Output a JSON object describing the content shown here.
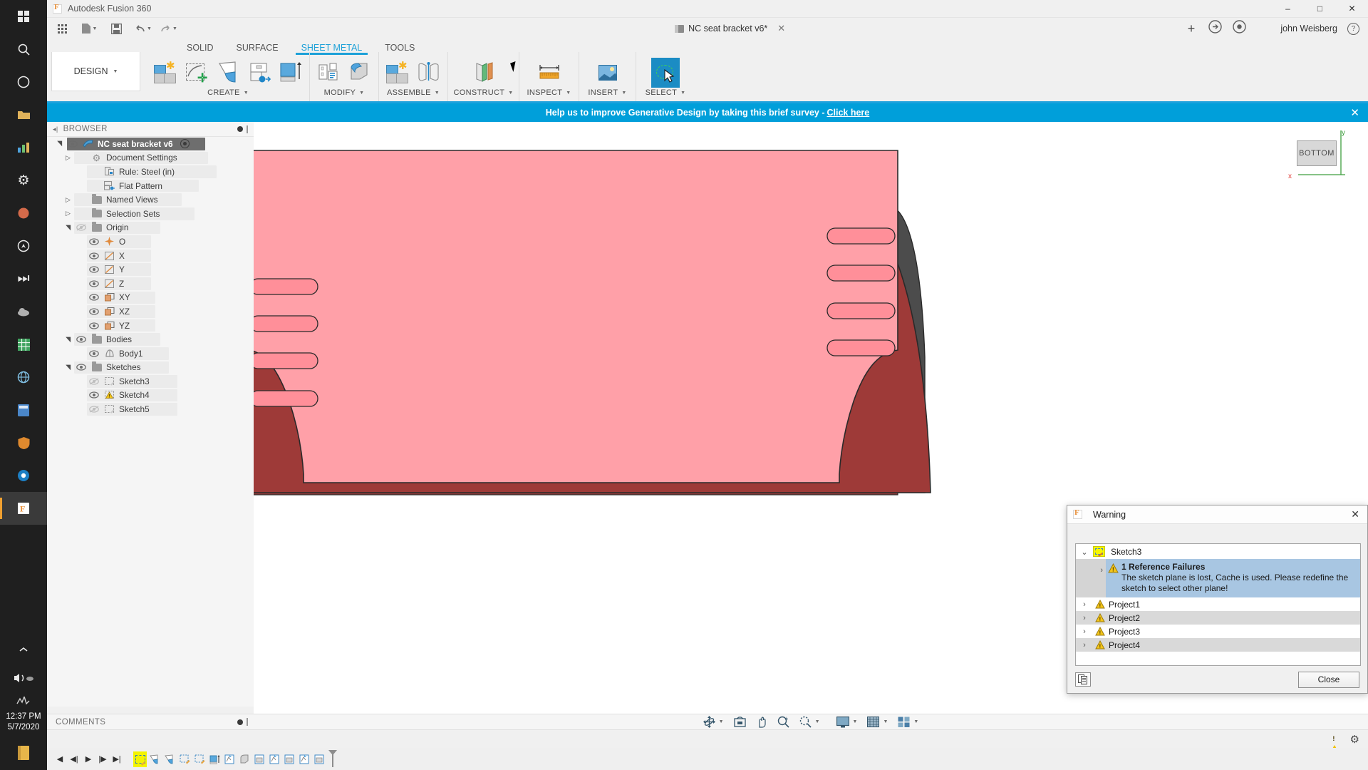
{
  "window": {
    "app_title": "Autodesk Fusion 360",
    "minimize": "–",
    "maximize": "□",
    "close": "✕"
  },
  "taskbar": {
    "clock_time": "12:37 PM",
    "clock_date": "5/7/2020",
    "icons": [
      "windows-start-icon",
      "search-icon",
      "circle-icon",
      "folder-icon",
      "chart-icon",
      "gear-icon",
      "paint-icon",
      "compass-icon",
      "skip-icon",
      "cloud-icon",
      "grid-icon",
      "globe-icon",
      "calculator-icon",
      "shield-icon",
      "browser-icon",
      "fusion-icon"
    ],
    "tray": [
      "chevron-up-icon",
      "volume-icon",
      "cloud-icon",
      "activity-icon"
    ],
    "bottom": [
      "book-icon"
    ]
  },
  "quick_access": {
    "apps_label": "",
    "new_label": "",
    "save_label": "",
    "undo_label": "",
    "redo_label": "",
    "document_tab": "NC seat bracket v6*",
    "tab_close": "✕",
    "add_tab": "+",
    "user_name": "john Weisberg",
    "help_label": "?"
  },
  "ribbon": {
    "design_dropdown": "DESIGN",
    "workspace_tabs": [
      {
        "label": "SOLID",
        "active": false
      },
      {
        "label": "SURFACE",
        "active": false
      },
      {
        "label": "SHEET METAL",
        "active": true
      },
      {
        "label": "TOOLS",
        "active": false
      }
    ],
    "groups": [
      {
        "label": "CREATE",
        "has_caret": true,
        "icons": [
          "new-sheet-metal-component-icon",
          "create-sketch-icon",
          "flange-icon",
          "unfold-icon",
          "extrude-icon"
        ]
      },
      {
        "label": "MODIFY",
        "has_caret": true,
        "icons": [
          "press-pull-icon",
          "fillet-icon"
        ]
      },
      {
        "label": "ASSEMBLE",
        "has_caret": true,
        "icons": [
          "new-component-icon",
          "joint-icon"
        ]
      },
      {
        "label": "CONSTRUCT",
        "has_caret": true,
        "icons": [
          "offset-plane-icon"
        ]
      },
      {
        "label": "INSPECT",
        "has_caret": true,
        "icons": [
          "measure-icon"
        ]
      },
      {
        "label": "INSERT",
        "has_caret": true,
        "icons": [
          "insert-image-icon"
        ]
      },
      {
        "label": "SELECT",
        "has_caret": true,
        "icons": [
          "select-icon"
        ],
        "selected": true
      }
    ]
  },
  "banner": {
    "text": "Help us to improve Generative Design by taking this brief survey -",
    "link": "Click here",
    "close": "✕"
  },
  "browser": {
    "title": "BROWSER",
    "tree": [
      {
        "label": "NC seat bracket v6",
        "indent": 0,
        "tri": "open",
        "eye": true,
        "icon": "component-icon",
        "root": true,
        "target": true
      },
      {
        "label": "Document Settings",
        "indent": 1,
        "tri": "closed",
        "eye": false,
        "icon": "gear-icon"
      },
      {
        "label": "Rule: Steel (in)",
        "indent": 2,
        "tri": "none",
        "eye": false,
        "icon": "rule-icon"
      },
      {
        "label": "Flat Pattern",
        "indent": 2,
        "tri": "none",
        "eye": false,
        "icon": "flat-pattern-icon"
      },
      {
        "label": "Named Views",
        "indent": 1,
        "tri": "closed",
        "eye": false,
        "icon": "folder-icon"
      },
      {
        "label": "Selection Sets",
        "indent": 1,
        "tri": "closed",
        "eye": false,
        "icon": "folder-icon"
      },
      {
        "label": "Origin",
        "indent": 1,
        "tri": "open",
        "eye": true,
        "eye_off": true,
        "icon": "folder-icon"
      },
      {
        "label": "O",
        "indent": 2,
        "tri": "none",
        "eye": true,
        "icon": "origin-point-icon"
      },
      {
        "label": "X",
        "indent": 2,
        "tri": "none",
        "eye": true,
        "icon": "axis-icon"
      },
      {
        "label": "Y",
        "indent": 2,
        "tri": "none",
        "eye": true,
        "icon": "axis-icon"
      },
      {
        "label": "Z",
        "indent": 2,
        "tri": "none",
        "eye": true,
        "icon": "axis-icon"
      },
      {
        "label": "XY",
        "indent": 2,
        "tri": "none",
        "eye": true,
        "icon": "plane-icon"
      },
      {
        "label": "XZ",
        "indent": 2,
        "tri": "none",
        "eye": true,
        "icon": "plane-icon"
      },
      {
        "label": "YZ",
        "indent": 2,
        "tri": "none",
        "eye": true,
        "icon": "plane-icon"
      },
      {
        "label": "Bodies",
        "indent": 1,
        "tri": "open",
        "eye": true,
        "icon": "folder-icon"
      },
      {
        "label": "Body1",
        "indent": 2,
        "tri": "none",
        "eye": true,
        "icon": "body-icon"
      },
      {
        "label": "Sketches",
        "indent": 1,
        "tri": "open",
        "eye": true,
        "icon": "folder-icon"
      },
      {
        "label": "Sketch3",
        "indent": 2,
        "tri": "none",
        "eye": true,
        "eye_off": true,
        "icon": "sketch-icon"
      },
      {
        "label": "Sketch4",
        "indent": 2,
        "tri": "none",
        "eye": true,
        "icon": "sketch-warning-icon"
      },
      {
        "label": "Sketch5",
        "indent": 2,
        "tri": "none",
        "eye": true,
        "eye_off": true,
        "icon": "sketch-icon"
      }
    ]
  },
  "comments": {
    "title": "COMMENTS"
  },
  "canvas": {
    "viewcube_label": "BOTTOM",
    "axis_x": "x",
    "axis_y": "y",
    "model_name": "NC seat bracket sheet metal part",
    "colors": {
      "face_light": "#ffa0a8",
      "face_dark": "#9e3a38",
      "edge": "#2a2a2a",
      "side_gray": "#4c4c4c"
    }
  },
  "navbar": {
    "items": [
      {
        "name": "orbit-icon",
        "caret": true
      },
      {
        "name": "look-at-icon",
        "caret": false
      },
      {
        "name": "pan-icon",
        "caret": false
      },
      {
        "name": "zoom-icon",
        "caret": false
      },
      {
        "name": "fit-icon",
        "caret": true
      },
      {
        "name": "display-settings-icon",
        "caret": true
      },
      {
        "name": "grid-settings-icon",
        "caret": true
      },
      {
        "name": "viewports-icon",
        "caret": true
      }
    ]
  },
  "statusbar": {
    "warning_icon": "warning-triangle-icon",
    "settings_icon": "gear-icon"
  },
  "timeline": {
    "nav": [
      "◀",
      "◀|",
      "▶",
      "|▶",
      "▶|"
    ],
    "items": [
      {
        "name": "sketch-feature",
        "selected": true
      },
      {
        "name": "flange-feature-1"
      },
      {
        "name": "flange-feature-2"
      },
      {
        "name": "sketch-edit-1"
      },
      {
        "name": "sketch-edit-2"
      },
      {
        "name": "extrude-feature"
      },
      {
        "name": "cut-feature-1"
      },
      {
        "name": "fillet-feature"
      },
      {
        "name": "pattern-feature-1"
      },
      {
        "name": "cut-feature-2"
      },
      {
        "name": "pattern-feature-2"
      },
      {
        "name": "cut-feature-3"
      },
      {
        "name": "pattern-feature-3"
      }
    ]
  },
  "warning_dialog": {
    "title": "Warning",
    "close": "✕",
    "root": {
      "label": "Sketch3",
      "expanded": true,
      "chevron": "⌄"
    },
    "entries": [
      {
        "title": "1 Reference Failures",
        "detail": "The sketch plane is lost, Cache is used. Please redefine the sketch to select other plane!",
        "selected": true,
        "chevron": "›"
      },
      {
        "title": "Project1",
        "chevron": "›",
        "alt": false
      },
      {
        "title": "Project2",
        "chevron": "›",
        "alt": true
      },
      {
        "title": "Project3",
        "chevron": "›",
        "alt": false
      },
      {
        "title": "Project4",
        "chevron": "›",
        "alt": true
      }
    ],
    "copy_icon": "copy-to-clipboard-icon",
    "close_button": "Close"
  }
}
